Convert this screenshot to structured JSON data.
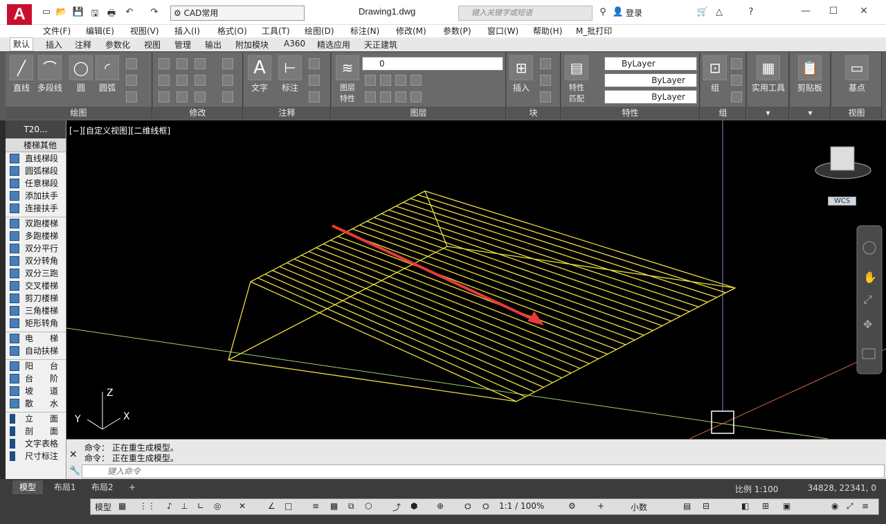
{
  "app": {
    "logo": "A",
    "workspace": "CAD常用",
    "title": "Drawing1.dwg",
    "search_placeholder": "键入关键字或短语",
    "login": "登录"
  },
  "menu": [
    "文件(F)",
    "编辑(E)",
    "视图(V)",
    "插入(I)",
    "格式(O)",
    "工具(T)",
    "绘图(D)",
    "标注(N)",
    "修改(M)",
    "参数(P)",
    "窗口(W)",
    "帮助(H)",
    "M_批打印"
  ],
  "ribbon_tabs": [
    "默认",
    "插入",
    "注释",
    "参数化",
    "视图",
    "管理",
    "输出",
    "附加模块",
    "A360",
    "精选应用",
    "天正建筑"
  ],
  "panels": {
    "draw": {
      "title": "绘图",
      "buttons": [
        "直线",
        "多段线",
        "圆",
        "圆弧"
      ]
    },
    "modify": {
      "title": "修改"
    },
    "annotate": {
      "title": "注释",
      "buttons": [
        "文字",
        "标注"
      ]
    },
    "layers": {
      "title": "图层",
      "button": "图层\n特性",
      "current": "0"
    },
    "block": {
      "title": "块",
      "button": "插入"
    },
    "props": {
      "title": "特性",
      "button": "特性\n匹配",
      "bylayer": [
        "ByLayer",
        "ByLayer",
        "ByLayer"
      ]
    },
    "groups": {
      "title": "组",
      "button": "组"
    },
    "util": {
      "button": "实用工具"
    },
    "clip": {
      "button": "剪贴板"
    },
    "view": {
      "title": "视图",
      "button": "基点"
    }
  },
  "viewport": {
    "label": "[−][自定义视图][二维线框]",
    "wcs": "WCS",
    "axes": {
      "x": "X",
      "y": "Y",
      "z": "Z"
    }
  },
  "left_panel": {
    "head": "T20...",
    "sections": [
      {
        "title": "楼梯其他",
        "items": [
          "直线梯段",
          "圆弧梯段",
          "任意梯段",
          "添加扶手",
          "连接扶手"
        ]
      },
      {
        "title": "",
        "items": [
          "双跑楼梯",
          "多跑楼梯",
          "双分平行",
          "双分转角",
          "双分三跑",
          "交叉楼梯",
          "剪刀楼梯",
          "三角楼梯",
          "矩形转角"
        ]
      },
      {
        "title": "",
        "items": [
          "电　　梯",
          "自动扶梯"
        ]
      },
      {
        "title": "",
        "items": [
          "阳　　台",
          "台　　阶",
          "坡　　道",
          "散　　水"
        ]
      },
      {
        "title": "",
        "items": [
          "立　　面",
          "剖　　面",
          "文字表格",
          "尺寸标注"
        ]
      }
    ]
  },
  "command": {
    "lines": [
      "命令：  正在重生成模型。",
      "命令：  正在重生成模型。"
    ],
    "placeholder": "键入命令"
  },
  "layout_tabs": [
    "模型",
    "布局1",
    "布局2"
  ],
  "status": {
    "model": "模型",
    "scale_ratio": "1:1 / 100%",
    "units": "小数",
    "drawing_scale": "比例 1:100",
    "coords": "34828, 22341, 0"
  }
}
